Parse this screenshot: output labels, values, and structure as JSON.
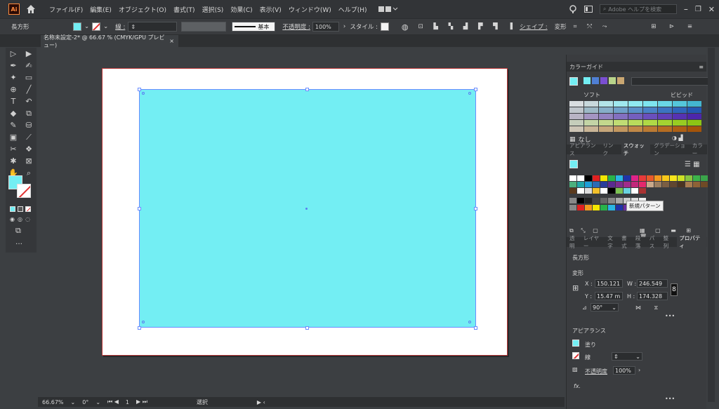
{
  "menubar": {
    "logo": "Ai",
    "items": [
      "ファイル(F)",
      "編集(E)",
      "オブジェクト(O)",
      "書式(T)",
      "選択(S)",
      "効果(C)",
      "表示(V)",
      "ウィンドウ(W)",
      "ヘルプ(H)"
    ],
    "search_placeholder": "Adobe ヘルプを検索"
  },
  "controlbar": {
    "object_type": "長方形",
    "stroke_label": "線 :",
    "stroke_style": "基本",
    "opacity_label": "不透明度 :",
    "opacity_value": "100%",
    "style_label": "スタイル :",
    "shape_label": "シェイプ :",
    "transform_label": "変形"
  },
  "document": {
    "tab_title": "名称未設定-2* @ 66.67 % (CMYK/GPU プレビュー)",
    "close": "×"
  },
  "colors": {
    "fill": "#73eef3",
    "stroke": "none"
  },
  "statusbar": {
    "zoom": "66.67%",
    "rotation": "0°",
    "artboard": "1",
    "tool": "選択"
  },
  "panels": {
    "color_guide": {
      "title": "カラーガイド",
      "soft": "ソフト",
      "vivid": "ビビッド",
      "none": "なし"
    },
    "swatch_tabs": [
      "アピアランス",
      "リンク",
      "スウォッチ",
      "グラデーション",
      "カラー"
    ],
    "active_swatch_tab": "スウォッチ",
    "tooltip": "新規パターン",
    "prop_tabs": [
      "透明",
      "レイヤー",
      "文字",
      "書式",
      "段落",
      "パス",
      "整列",
      "プロパティ"
    ],
    "properties": {
      "object": "長方形",
      "transform_title": "変形",
      "x_label": "X :",
      "x_value": "150.121",
      "y_label": "Y :",
      "y_value": "15.47 m",
      "w_label": "W :",
      "w_value": "246.549",
      "h_label": "H :",
      "h_value": "174.328",
      "angle": "90°",
      "appearance_title": "アピアランス",
      "fill_label": "塗り",
      "stroke_label": "線",
      "opacity_label": "不透明度",
      "opacity_value": "100%",
      "fx": "fx."
    }
  }
}
